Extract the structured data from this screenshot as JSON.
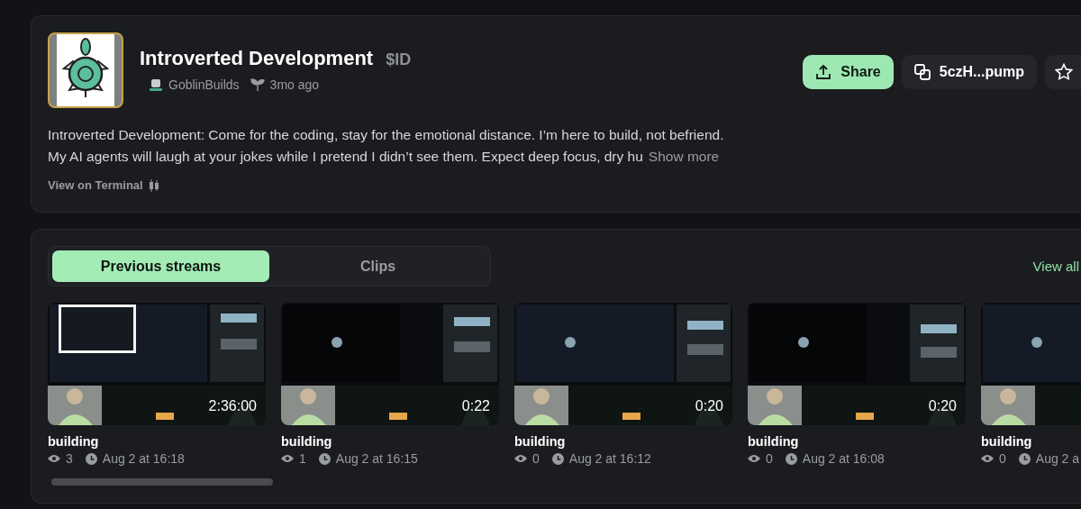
{
  "token": {
    "name": "Introverted Development",
    "ticker": "$ID",
    "creator": "GoblinBuilds",
    "age": "3mo ago",
    "description_lines": [
      "Introverted Development: Come for the coding, stay for the emotional distance. I’m here to build, not befriend.",
      "My AI agents will laugh at your jokes while I pretend I didn’t see them. Expect deep focus, dry hu"
    ],
    "show_more": "Show more",
    "terminal_link": "View on Terminal"
  },
  "actions": {
    "share": "Share",
    "address": "5czH...pump"
  },
  "streams": {
    "tabs": [
      {
        "label": "Previous streams",
        "selected": true
      },
      {
        "label": "Clips",
        "selected": false
      }
    ],
    "view_all": "View all",
    "videos": [
      {
        "title": "building",
        "duration": "2:36:00",
        "views": "3",
        "date": "Aug 2 at 16:18"
      },
      {
        "title": "building",
        "duration": "0:22",
        "views": "1",
        "date": "Aug 2 at 16:15"
      },
      {
        "title": "building",
        "duration": "0:20",
        "views": "0",
        "date": "Aug 2 at 16:12"
      },
      {
        "title": "building",
        "duration": "0:20",
        "views": "0",
        "date": "Aug 2 at 16:08"
      },
      {
        "title": "building",
        "views": "0",
        "date": "Aug 2 a"
      }
    ]
  }
}
